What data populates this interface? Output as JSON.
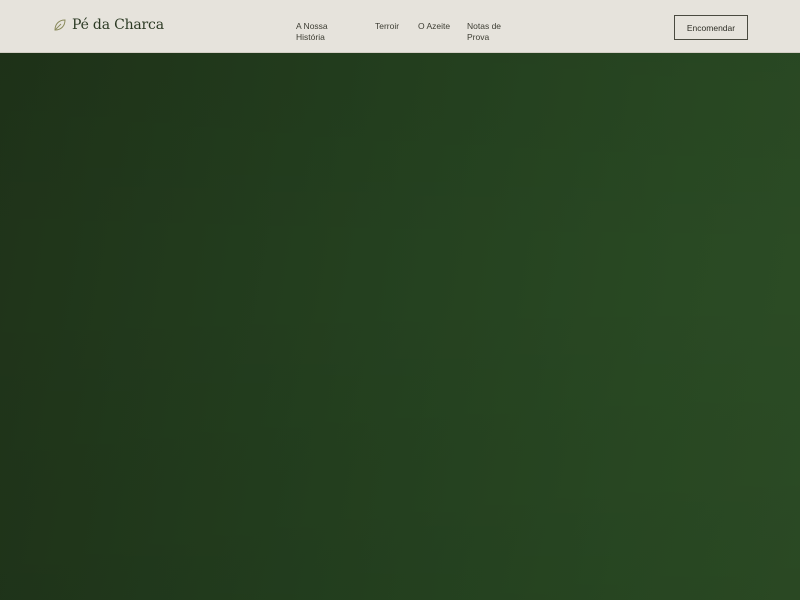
{
  "header": {
    "brand": {
      "name": "Pé da Charca",
      "icon": "leaf-icon"
    },
    "nav": [
      {
        "label": "A Nossa História"
      },
      {
        "label": "Terroir"
      },
      {
        "label": "O Azeite"
      },
      {
        "label": "Notas de Prova"
      }
    ],
    "order_label": "Encomendar"
  },
  "colors": {
    "header_background": "#e6e3dc",
    "hero_green_dark": "#1f3319",
    "hero_green_light": "#2c4c25",
    "brand_text": "#2c3a24",
    "leaf_accent": "#8a8a5c"
  }
}
